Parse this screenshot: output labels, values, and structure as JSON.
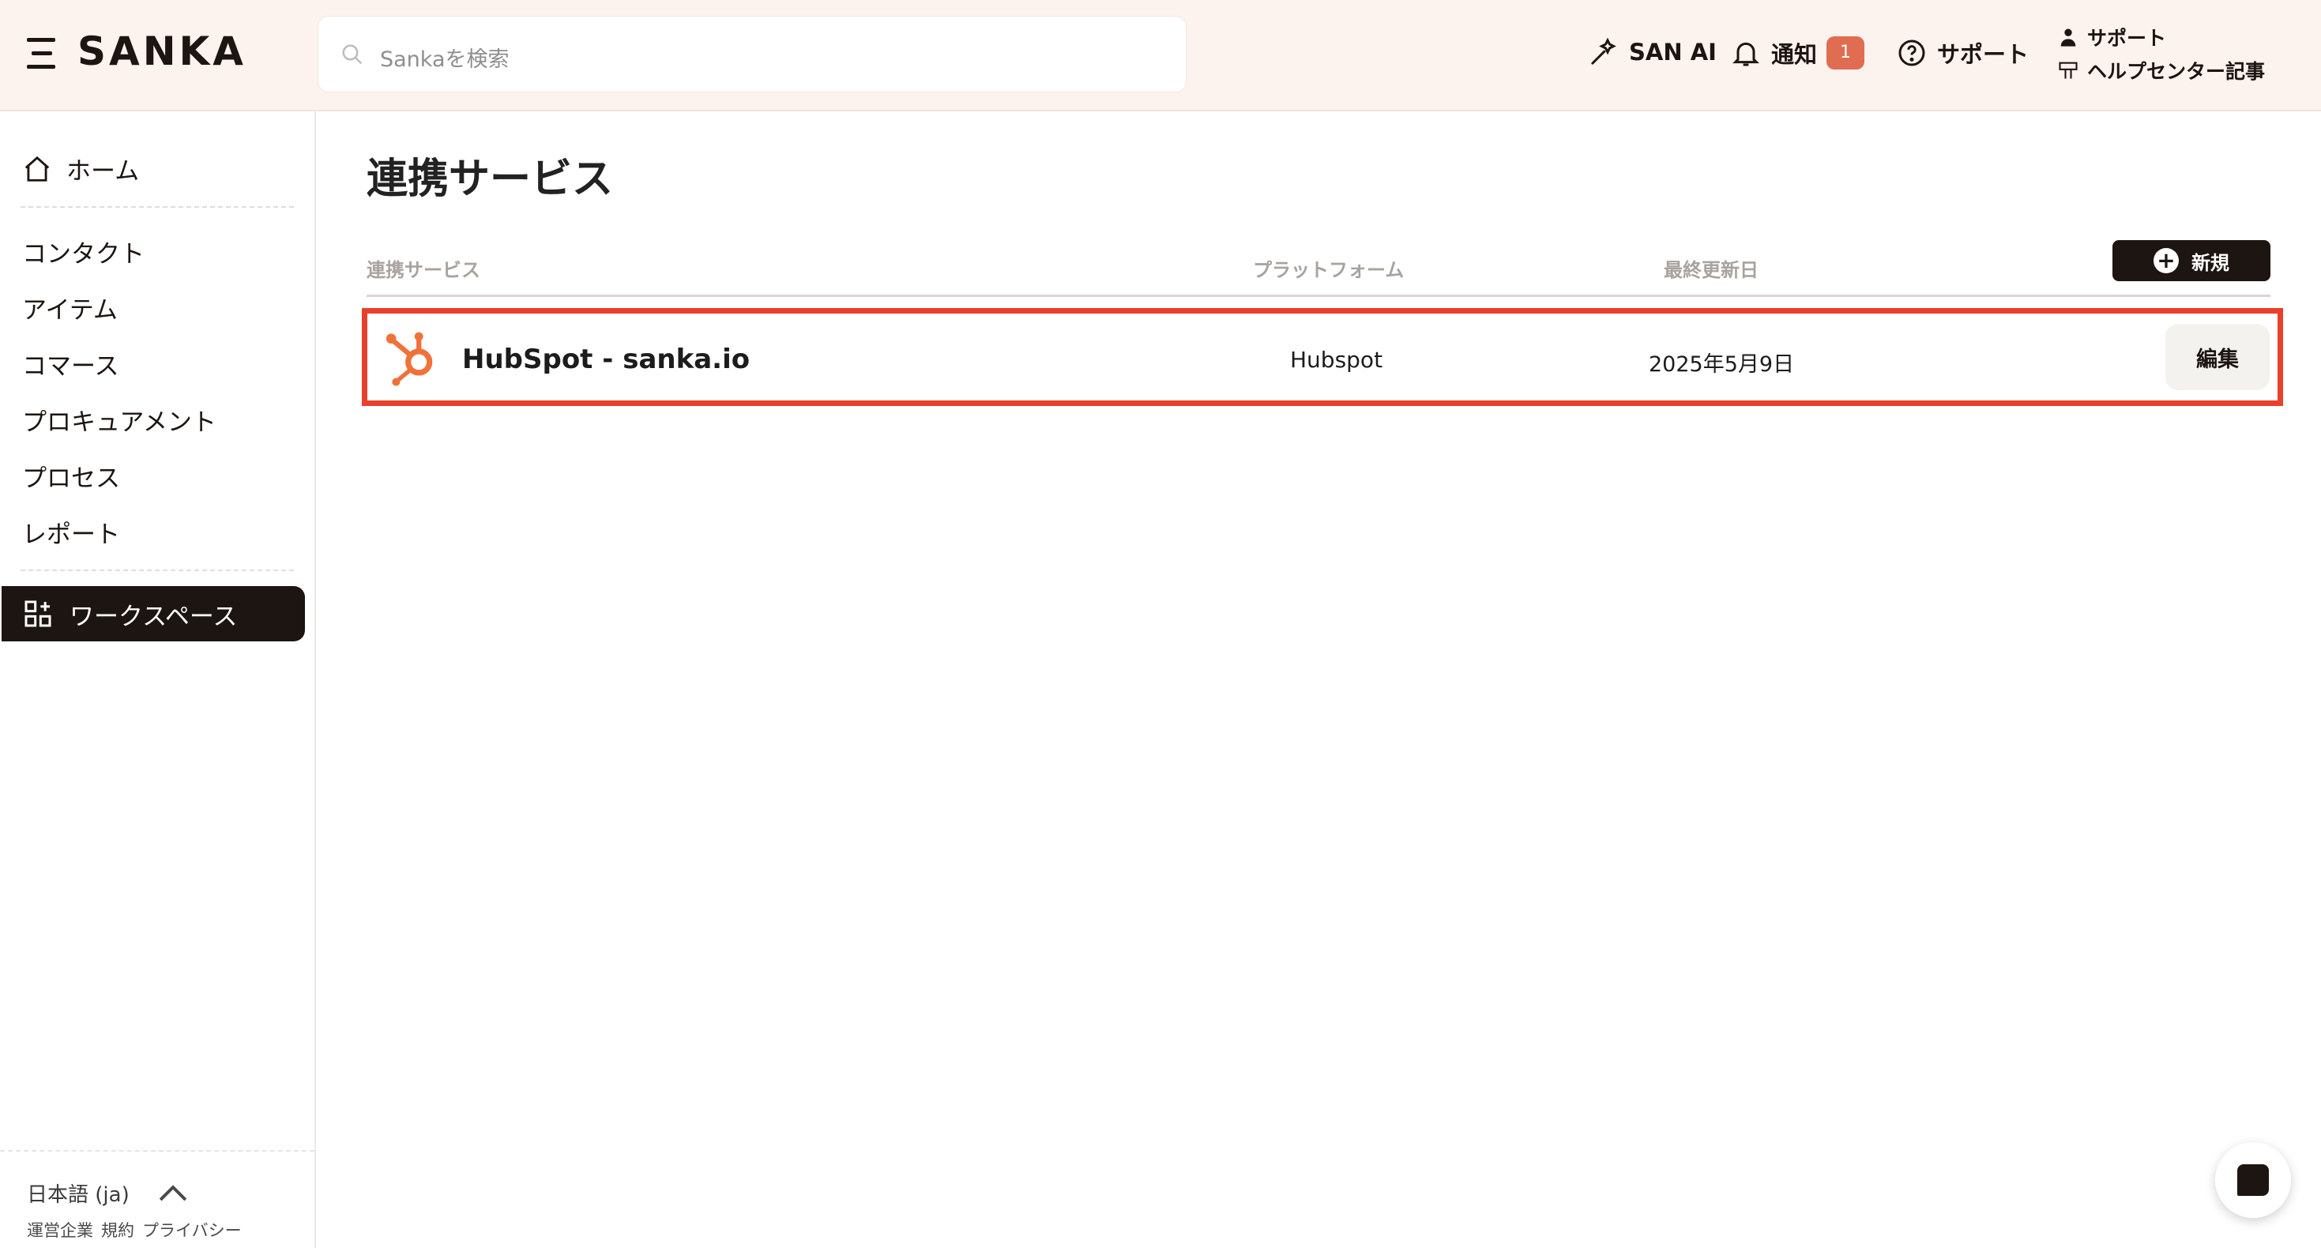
{
  "header": {
    "brand": "SANKA",
    "search_placeholder": "Sankaを検索",
    "san_ai": "SAN AI",
    "notifications_label": "通知",
    "notifications_count": "1",
    "support_label": "サポート",
    "support_stack": {
      "support": "サポート",
      "help_center": "ヘルプセンター記事"
    }
  },
  "sidebar": {
    "home": "ホーム",
    "items": [
      "コンタクト",
      "アイテム",
      "コマース",
      "プロキュアメント",
      "プロセス",
      "レポート"
    ],
    "workspace": "ワークスペース",
    "language": "日本語 (ja)",
    "footer_links": [
      "運営企業",
      "規約",
      "プライバシー"
    ]
  },
  "main": {
    "title": "連携サービス",
    "columns": {
      "service": "連携サービス",
      "platform": "プラットフォーム",
      "updated": "最終更新日"
    },
    "new_button": "新規",
    "rows": [
      {
        "name": "HubSpot - sanka.io",
        "platform": "Hubspot",
        "updated": "2025年5月9日",
        "edit_label": "編集"
      }
    ]
  },
  "colors": {
    "accent": "#1c1512",
    "header_bg": "#fcf2ee",
    "badge": "#e06d52",
    "highlight": "#e8402c",
    "hubspot": "#f0723a"
  }
}
